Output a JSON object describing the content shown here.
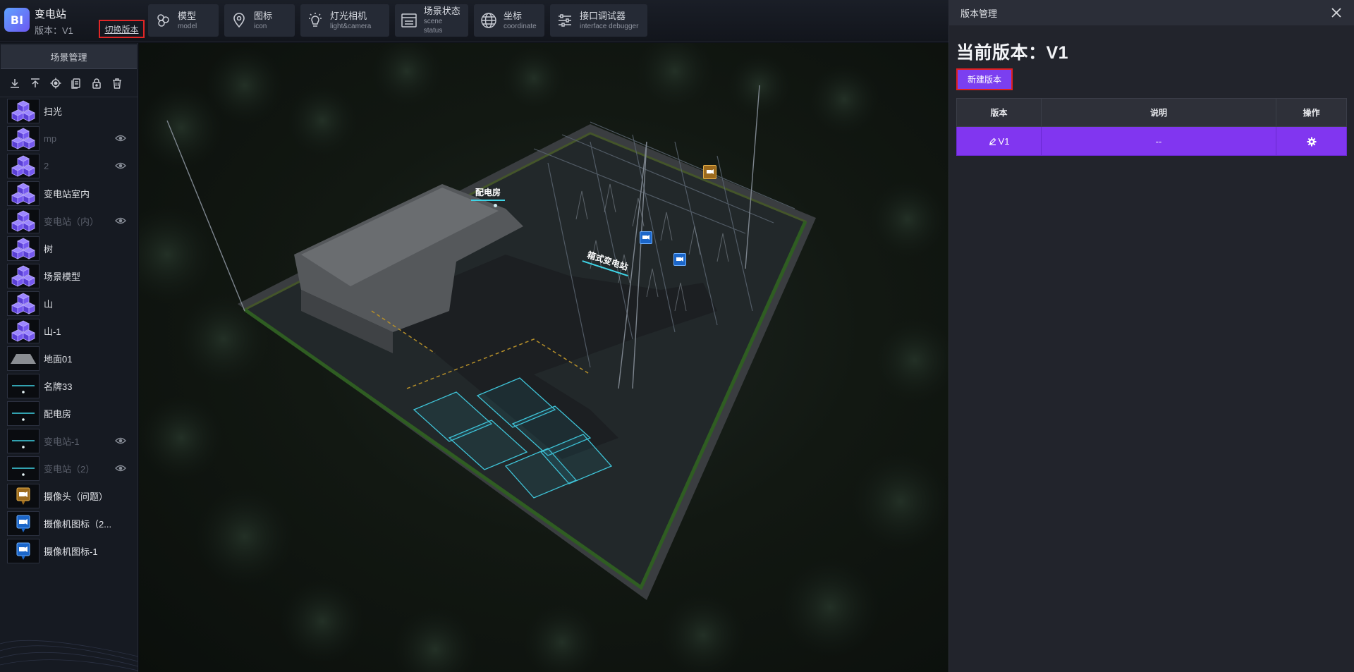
{
  "header": {
    "logo_text": "BI",
    "app_title": "变电站",
    "version_line": "版本：V1",
    "switch_version_label": "切换版本"
  },
  "toolbar": [
    {
      "zh": "模型",
      "en": "model",
      "icon": "model-icon"
    },
    {
      "zh": "图标",
      "en": "icon",
      "icon": "location-pin-icon"
    },
    {
      "zh": "灯光相机",
      "en": "light&camera",
      "icon": "lightbulb-icon"
    },
    {
      "zh": "场景状态",
      "en": "scene status",
      "icon": "scene-status-icon"
    },
    {
      "zh": "坐标",
      "en": "coordinate",
      "icon": "globe-icon"
    },
    {
      "zh": "接口调试器",
      "en": "interface debugger",
      "icon": "sliders-icon"
    }
  ],
  "left_panel": {
    "tab_label": "场景管理",
    "tools": [
      "download-icon",
      "upload-icon",
      "locate-icon",
      "copy-icon",
      "lock-icon",
      "trash-icon"
    ],
    "layers": [
      {
        "name": "扫光",
        "thumb": "cubes",
        "dim": false,
        "eye": false
      },
      {
        "name": "mp",
        "thumb": "cubes",
        "dim": true,
        "eye": true
      },
      {
        "name": "2",
        "thumb": "cubes",
        "dim": true,
        "eye": true
      },
      {
        "name": "变电站室内",
        "thumb": "cubes",
        "dim": false,
        "eye": false
      },
      {
        "name": "变电站（内）",
        "thumb": "cubes",
        "dim": true,
        "eye": true
      },
      {
        "name": "树",
        "thumb": "cubes",
        "dim": false,
        "eye": false
      },
      {
        "name": "场景模型",
        "thumb": "cubes",
        "dim": false,
        "eye": false
      },
      {
        "name": "山",
        "thumb": "cubes",
        "dim": false,
        "eye": false
      },
      {
        "name": "山-1",
        "thumb": "cubes",
        "dim": false,
        "eye": false
      },
      {
        "name": "地面01",
        "thumb": "plane",
        "dim": false,
        "eye": false
      },
      {
        "name": "名牌33",
        "thumb": "label",
        "dim": false,
        "eye": false
      },
      {
        "name": "配电房",
        "thumb": "label",
        "dim": false,
        "eye": false
      },
      {
        "name": "变电站-1",
        "thumb": "label",
        "dim": true,
        "eye": true
      },
      {
        "name": "变电站（2）",
        "thumb": "label",
        "dim": true,
        "eye": true
      },
      {
        "name": "摄像头（问题）",
        "thumb": "camera-gold",
        "dim": false,
        "eye": false
      },
      {
        "name": "摄像机图标（2...",
        "thumb": "camera-blue",
        "dim": false,
        "eye": false
      },
      {
        "name": "摄像机图标-1",
        "thumb": "camera-blue",
        "dim": false,
        "eye": false
      }
    ]
  },
  "scene": {
    "label_power_room": "配电房",
    "label_substation": "箱式变电站"
  },
  "right_panel": {
    "title": "版本管理",
    "current_version": "当前版本：V1",
    "new_version_label": "新建版本",
    "table_headers": [
      "版本",
      "说明",
      "操作"
    ],
    "rows": [
      {
        "version": "V1",
        "description": "--"
      }
    ]
  },
  "colors": {
    "accent": "#8136f0",
    "highlight_border": "#e02121",
    "panel_bg": "#22242c"
  }
}
